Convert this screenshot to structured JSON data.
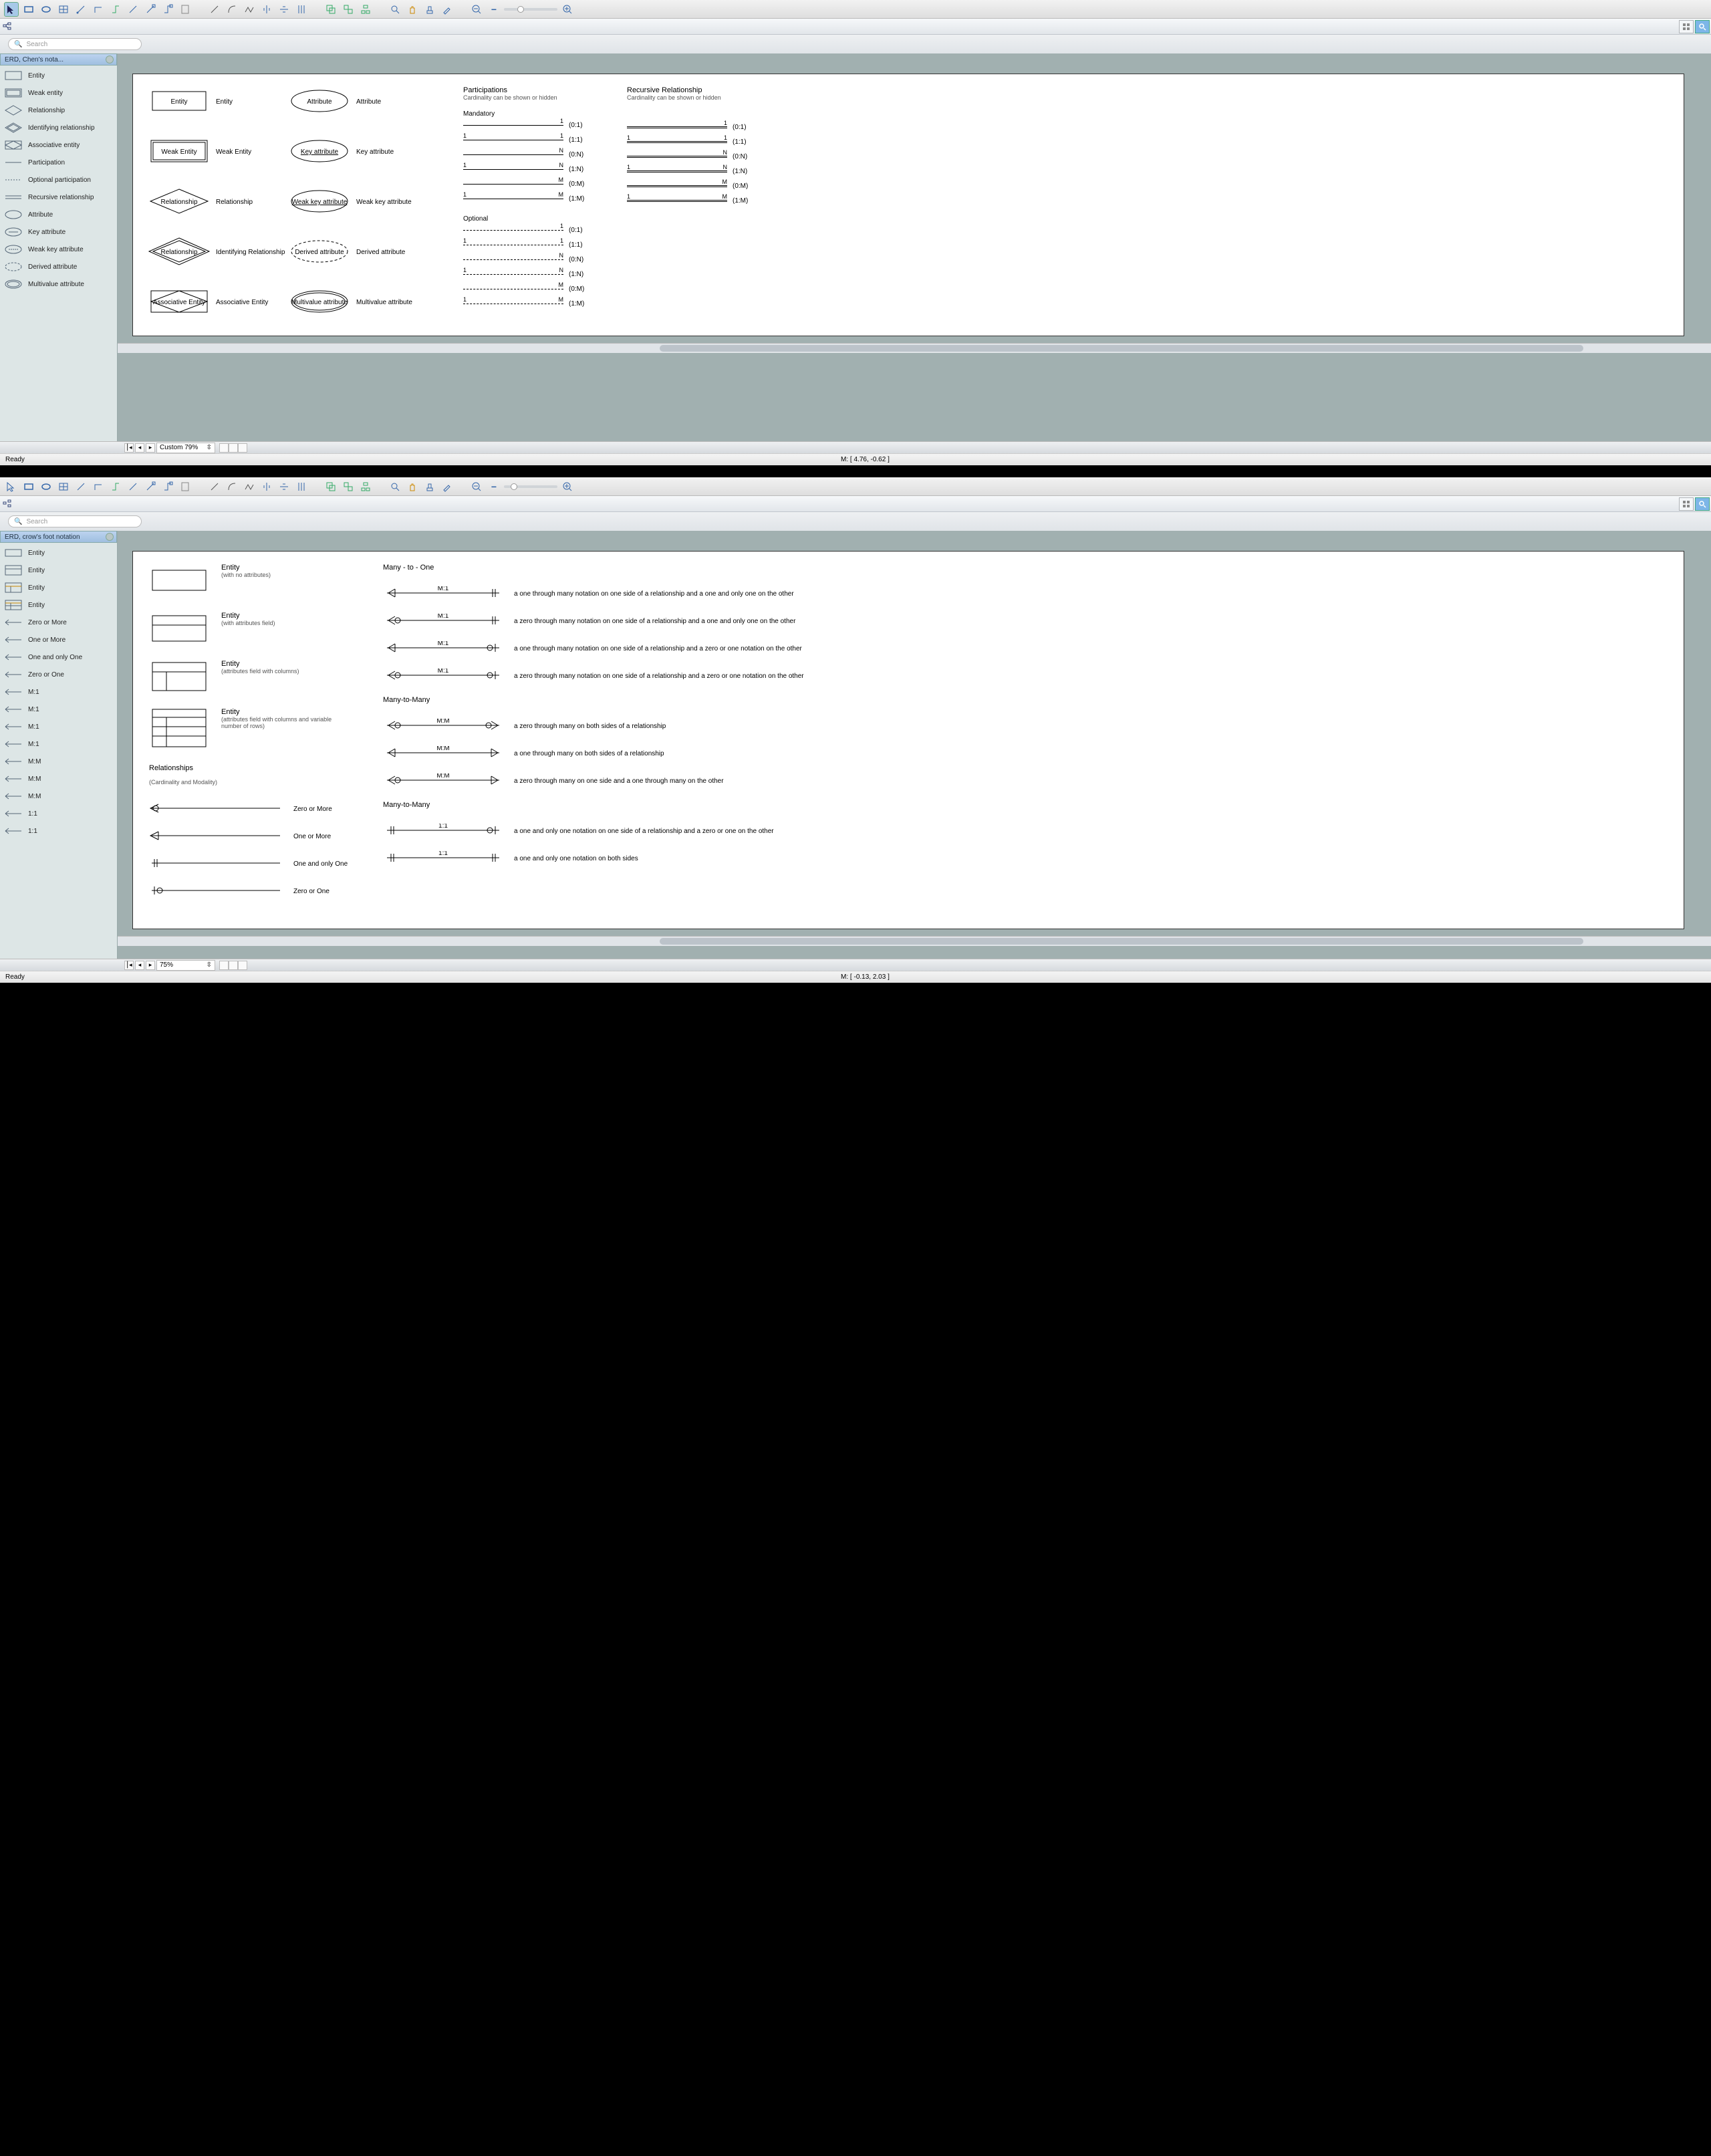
{
  "app1": {
    "search_placeholder": "Search",
    "panel_title": "ERD, Chen's nota...",
    "palette": [
      {
        "label": "Entity",
        "shape": "entity"
      },
      {
        "label": "Weak entity",
        "shape": "weak-entity"
      },
      {
        "label": "Relationship",
        "shape": "relationship"
      },
      {
        "label": "Identifying relationship",
        "shape": "identifying-relationship"
      },
      {
        "label": "Associative entity",
        "shape": "associative-entity"
      },
      {
        "label": "Participation",
        "shape": "participation"
      },
      {
        "label": "Optional participation",
        "shape": "optional-participation"
      },
      {
        "label": "Recursive relationship",
        "shape": "recursive-relationship"
      },
      {
        "label": "Attribute",
        "shape": "attribute"
      },
      {
        "label": "Key attribute",
        "shape": "key-attribute"
      },
      {
        "label": "Weak key attribute",
        "shape": "weak-key-attribute"
      },
      {
        "label": "Derived attribute",
        "shape": "derived-attribute"
      },
      {
        "label": "Multivalue attribute",
        "shape": "multivalue-attribute"
      }
    ],
    "zoom_label": "Custom 79%",
    "status_ready": "Ready",
    "coord": "M: [ 4.76, -0.62 ]",
    "canvas": {
      "col1": [
        {
          "shape_text": "Entity",
          "label": "Entity"
        },
        {
          "shape_text": "Weak Entity",
          "label": "Weak Entity"
        },
        {
          "shape_text": "Relationship",
          "label": "Relationship"
        },
        {
          "shape_text": "Relationship",
          "label": "Identifying Relationship"
        },
        {
          "shape_text": "Associative Entity",
          "label": "Associative Entity"
        }
      ],
      "col2": [
        {
          "shape_text": "Attribute",
          "label": "Attribute"
        },
        {
          "shape_text": "Key attribute",
          "label": "Key attribute"
        },
        {
          "shape_text": "Weak key attribute",
          "label": "Weak key attribute"
        },
        {
          "shape_text": "Derived attribute",
          "label": "Derived attribute"
        },
        {
          "shape_text": "Multivalue attribute",
          "label": "Multivalue attribute"
        }
      ],
      "participations_title": "Participations",
      "participations_sub": "Cardinality can be shown or hidden",
      "recursive_title": "Recursive Relationship",
      "recursive_sub": "Cardinality can be shown or hidden",
      "mandatory_label": "Mandatory",
      "optional_label": "Optional",
      "mandatory_rows": [
        {
          "l": "",
          "r": "1",
          "card": "(0:1)"
        },
        {
          "l": "1",
          "r": "1",
          "card": "(1:1)"
        },
        {
          "l": "",
          "r": "N",
          "card": "(0:N)"
        },
        {
          "l": "1",
          "r": "N",
          "card": "(1:N)"
        },
        {
          "l": "",
          "r": "M",
          "card": "(0:M)"
        },
        {
          "l": "1",
          "r": "M",
          "card": "(1:M)"
        }
      ],
      "optional_rows": [
        {
          "l": "",
          "r": "1",
          "card": "(0:1)"
        },
        {
          "l": "1",
          "r": "1",
          "card": "(1:1)"
        },
        {
          "l": "",
          "r": "N",
          "card": "(0:N)"
        },
        {
          "l": "1",
          "r": "N",
          "card": "(1:N)"
        },
        {
          "l": "",
          "r": "M",
          "card": "(0:M)"
        },
        {
          "l": "1",
          "r": "M",
          "card": "(1:M)"
        }
      ]
    }
  },
  "app2": {
    "search_placeholder": "Search",
    "panel_title": "ERD, crow's foot notation",
    "palette": [
      {
        "label": "Entity",
        "shape": "cf-entity-1"
      },
      {
        "label": "Entity",
        "shape": "cf-entity-2"
      },
      {
        "label": "Entity",
        "shape": "cf-entity-3"
      },
      {
        "label": "Entity",
        "shape": "cf-entity-4"
      },
      {
        "label": "Zero or More",
        "shape": "cf-zom"
      },
      {
        "label": "One or More",
        "shape": "cf-oom"
      },
      {
        "label": "One and only One",
        "shape": "cf-ooo"
      },
      {
        "label": "Zero or One",
        "shape": "cf-zoo"
      },
      {
        "label": "M:1",
        "shape": "cf-m1-a"
      },
      {
        "label": "M:1",
        "shape": "cf-m1-b"
      },
      {
        "label": "M:1",
        "shape": "cf-m1-c"
      },
      {
        "label": "M:1",
        "shape": "cf-m1-d"
      },
      {
        "label": "M:M",
        "shape": "cf-mm-a"
      },
      {
        "label": "M:M",
        "shape": "cf-mm-b"
      },
      {
        "label": "M:M",
        "shape": "cf-mm-c"
      },
      {
        "label": "1:1",
        "shape": "cf-11-a"
      },
      {
        "label": "1:1",
        "shape": "cf-11-b"
      }
    ],
    "zoom_label": "75%",
    "status_ready": "Ready",
    "coord": "M: [ -0.13, 2.03 ]",
    "canvas": {
      "entity_rows": [
        {
          "title": "Entity",
          "desc": "(with no attributes)"
        },
        {
          "title": "Entity",
          "desc": "(with attributes field)"
        },
        {
          "title": "Entity",
          "desc": "(attributes field with columns)"
        },
        {
          "title": "Entity",
          "desc": "(attributes field with columns and variable number of rows)"
        }
      ],
      "rel_section_title": "Relationships",
      "rel_section_sub": "(Cardinality and Modality)",
      "basic_rels": [
        {
          "label": "Zero or More"
        },
        {
          "label": "One or More"
        },
        {
          "label": "One and only One"
        },
        {
          "label": "Zero or One"
        }
      ],
      "m1_title": "Many - to - One",
      "m1_rows": [
        {
          "ratio": "M:1",
          "desc": "a one through many notation on one side of a relationship and a one and only one on the other"
        },
        {
          "ratio": "M:1",
          "desc": "a zero through many notation on one side of a relationship and a one and only one on the other"
        },
        {
          "ratio": "M:1",
          "desc": "a one through many notation on one side of a relationship and a zero or one notation on the other"
        },
        {
          "ratio": "M:1",
          "desc": "a zero through many notation on one side of a relationship and a zero or one notation on the other"
        }
      ],
      "mm_title": "Many-to-Many",
      "mm_rows": [
        {
          "ratio": "M:M",
          "desc": "a zero through many on both sides of a relationship"
        },
        {
          "ratio": "M:M",
          "desc": "a one through many on both sides of a relationship"
        },
        {
          "ratio": "M:M",
          "desc": "a zero through many on one side and a one through many on the other"
        }
      ],
      "oo_title": "Many-to-Many",
      "oo_rows": [
        {
          "ratio": "1:1",
          "desc": "a one and only one notation on one side of a relationship and a zero or one on the other"
        },
        {
          "ratio": "1:1",
          "desc": "a one and only one notation on both sides"
        }
      ]
    }
  }
}
